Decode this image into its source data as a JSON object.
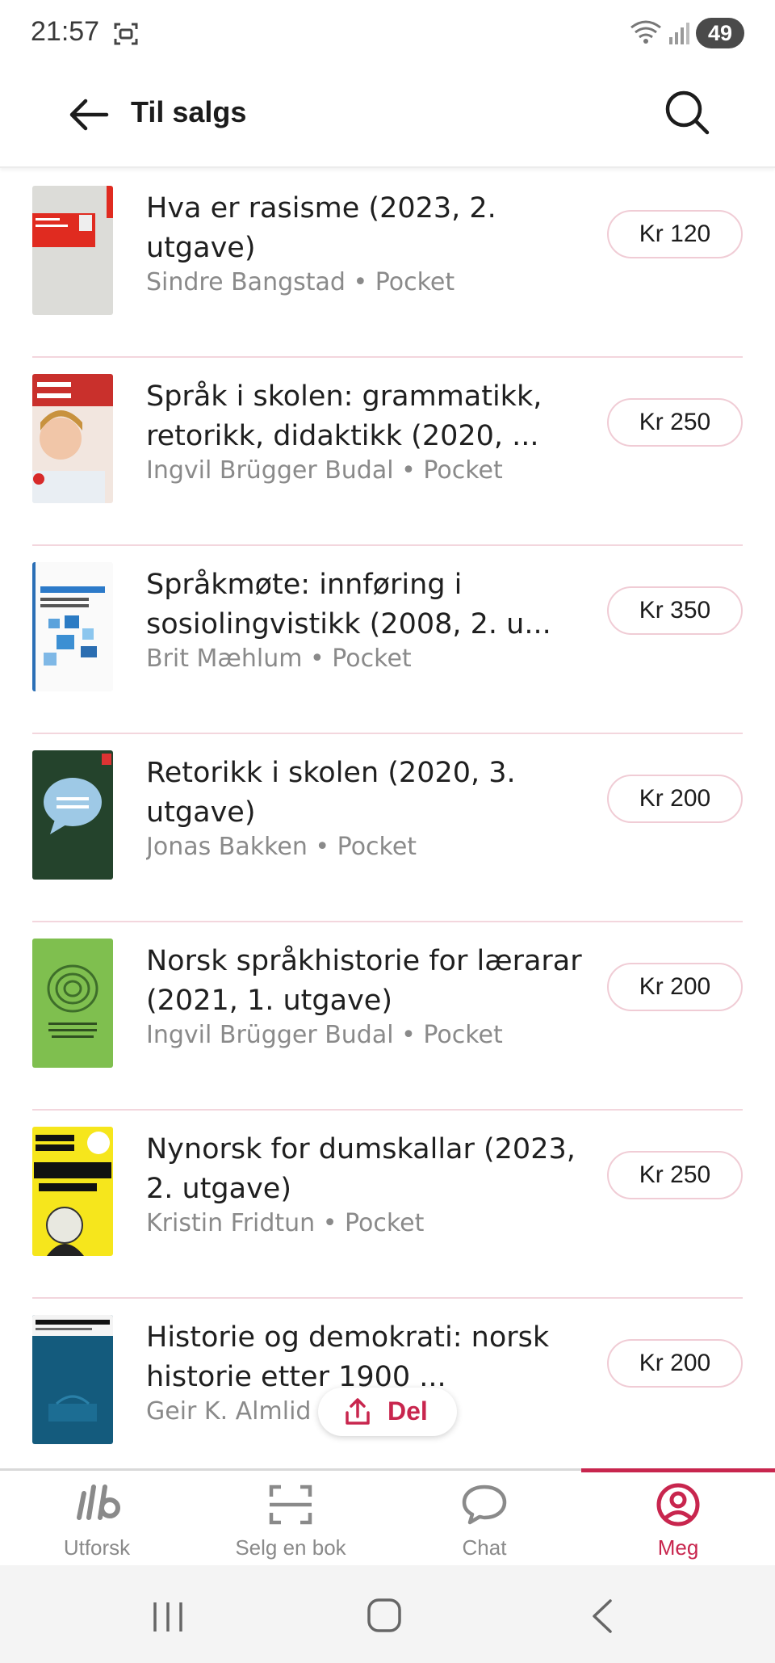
{
  "status_bar": {
    "time": "21:57",
    "battery": "49",
    "icons": [
      "screenshot-icon",
      "wifi-6e-icon",
      "signal-icon",
      "battery-icon"
    ]
  },
  "header": {
    "title": "Til salgs",
    "icons": [
      "arrow-left-icon",
      "search-icon"
    ]
  },
  "books": [
    {
      "title": "Hva er rasisme (2023, 2. utgave)",
      "author": "Sindre Bangstad",
      "format": "Pocket",
      "price": "Kr 120"
    },
    {
      "title": "Språk i skolen: grammatikk, retorikk, didaktikk (2020, ...",
      "author": "Ingvil Brügger Budal",
      "format": "Pocket",
      "price": "Kr 250"
    },
    {
      "title": "Språkmøte: innføring i sosiolingvistikk (2008, 2. u...",
      "author": "Brit Mæhlum",
      "format": "Pocket",
      "price": "Kr 350"
    },
    {
      "title": "Retorikk i skolen (2020, 3. utgave)",
      "author": "Jonas Bakken",
      "format": "Pocket",
      "price": "Kr 200"
    },
    {
      "title": "Norsk språkhistorie for lærarar (2021, 1. utgave)",
      "author": "Ingvil Brügger Budal",
      "format": "Pocket",
      "price": "Kr 200"
    },
    {
      "title": "Nynorsk for dumskallar (2023, 2. utgave)",
      "author": "Kristin Fridtun",
      "format": "Pocket",
      "price": "Kr 250"
    },
    {
      "title": "Historie og demokrati: norsk historie etter 1900 ...",
      "author": "Geir K. Almlid",
      "format": "",
      "price": "Kr 200"
    }
  ],
  "meta_separator": " • ",
  "share_button": {
    "label": "Del"
  },
  "bottom_nav": [
    {
      "label": "Utforsk",
      "icon": "lb-logo-icon",
      "active": false
    },
    {
      "label": "Selg en bok",
      "icon": "scan-icon",
      "active": false
    },
    {
      "label": "Chat",
      "icon": "chat-bubble-icon",
      "active": false
    },
    {
      "label": "Meg",
      "icon": "user-circle-icon",
      "active": true
    }
  ],
  "system_nav": {
    "icons": [
      "recent-apps-icon",
      "home-icon",
      "system-back-icon"
    ]
  },
  "colors": {
    "accent": "#c8264e",
    "divider": "#f3d6dd",
    "muted_text": "#8a8a8a"
  }
}
